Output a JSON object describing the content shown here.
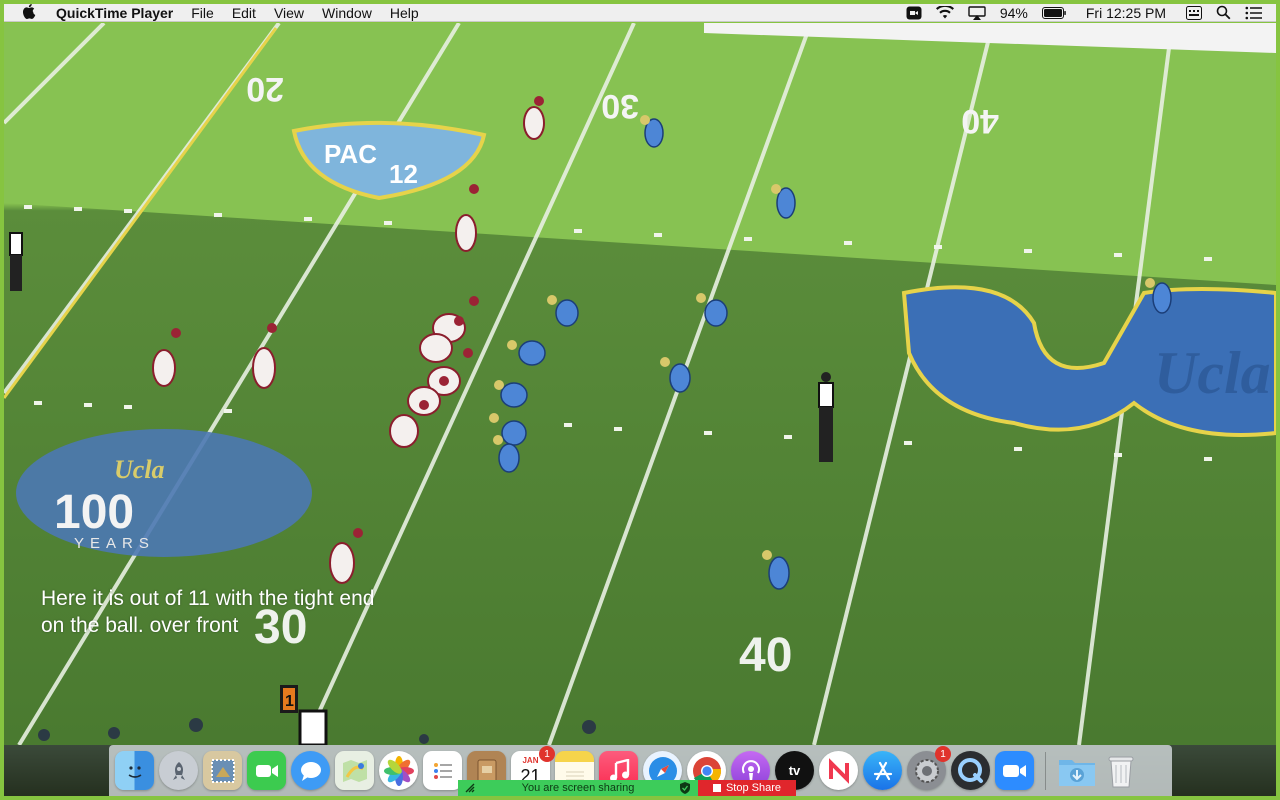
{
  "menubar": {
    "app_name": "QuickTime Player",
    "menus": [
      "File",
      "Edit",
      "View",
      "Window",
      "Help"
    ],
    "battery": "94%",
    "clock": "Fri 12:25 PM"
  },
  "video": {
    "caption": "Here it is out of 11 with the tight end on the ball. over front",
    "field_numbers": [
      "20",
      "30",
      "40",
      "30",
      "40"
    ],
    "logos": [
      "PAC 12",
      "UCLA 100 YEARS",
      "UCLA"
    ],
    "logo_text": {
      "pac": "PAC",
      "twelve": "12",
      "ucla_script": "Ucla",
      "hundred": "100",
      "years": "YEARS",
      "ucla_end": "Ucla"
    },
    "down_marker": "1"
  },
  "dock": {
    "apps": [
      {
        "name": "finder",
        "icon": "finder-icon"
      },
      {
        "name": "launchpad",
        "icon": "rocket-icon"
      },
      {
        "name": "mail",
        "icon": "stamp-icon"
      },
      {
        "name": "facetime",
        "icon": "video-camera-icon"
      },
      {
        "name": "messages",
        "icon": "speech-bubble-icon"
      },
      {
        "name": "maps",
        "icon": "map-icon"
      },
      {
        "name": "photos",
        "icon": "flower-icon"
      },
      {
        "name": "reminders",
        "icon": "checklist-icon"
      },
      {
        "name": "notebook",
        "icon": "notebook-icon"
      },
      {
        "name": "calendar",
        "icon": "calendar-icon",
        "month": "JAN",
        "day": "21",
        "badge": "1"
      },
      {
        "name": "notes",
        "icon": "notes-icon"
      },
      {
        "name": "music",
        "icon": "music-note-icon"
      },
      {
        "name": "safari",
        "icon": "compass-icon"
      },
      {
        "name": "chrome",
        "icon": "chrome-icon"
      },
      {
        "name": "podcasts",
        "icon": "podcast-icon"
      },
      {
        "name": "tv",
        "icon": "apple-tv-icon",
        "label": "tv"
      },
      {
        "name": "news",
        "icon": "news-icon"
      },
      {
        "name": "app-store",
        "icon": "app-store-icon"
      },
      {
        "name": "system-preferences",
        "icon": "gear-icon",
        "badge": "1"
      },
      {
        "name": "quicktime",
        "icon": "quicktime-icon"
      },
      {
        "name": "zoom",
        "icon": "zoom-camera-icon"
      },
      {
        "name": "downloads",
        "icon": "download-folder-icon"
      },
      {
        "name": "trash",
        "icon": "trash-icon"
      }
    ]
  },
  "share": {
    "status": "You are screen sharing",
    "stop_label": "Stop Share"
  },
  "colors": {
    "share_border": "#86c440",
    "turf_light": "#7fb84a",
    "turf_shadow": "#4c7c31",
    "ucla_blue": "#3b6fb6",
    "usc_cardinal": "#9b2335",
    "stop_red": "#e0262c",
    "share_green": "#3dcc5a"
  }
}
